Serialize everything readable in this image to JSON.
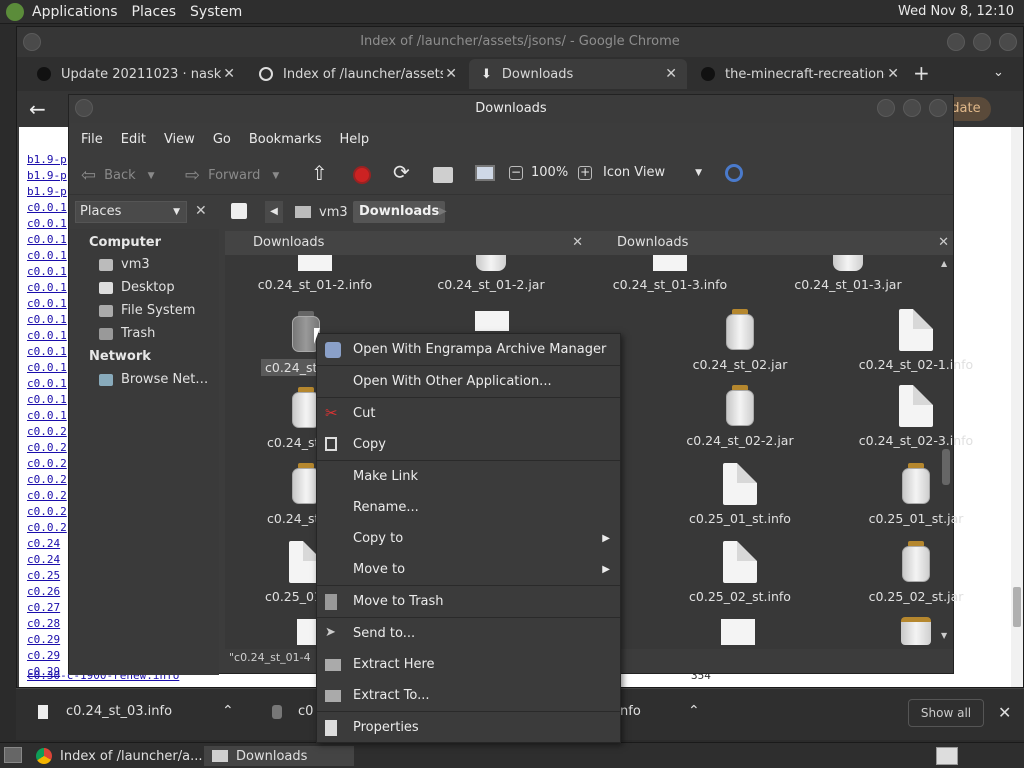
{
  "top_panel": {
    "applications": "Applications",
    "places": "Places",
    "system": "System",
    "clock": "Wed Nov  8, 12:10"
  },
  "chrome": {
    "title": "Index of /launcher/assets/jsons/ - Google Chrome",
    "tabs": [
      {
        "label": "Update 20211023 · nasko22"
      },
      {
        "label": "Index of /launcher/assets/j"
      },
      {
        "label": "Downloads"
      },
      {
        "label": "the-minecraft-recreation-"
      }
    ],
    "new_tab": "+",
    "update_btn": "pdate",
    "links": [
      "b1.9-p",
      "b1.9-p",
      "b1.9-p",
      "c0.0.1",
      "c0.0.1",
      "c0.0.1",
      "c0.0.1",
      "c0.0.1",
      "c0.0.1",
      "c0.0.1",
      "c0.0.1",
      "c0.0.1",
      "c0.0.1",
      "c0.0.1",
      "c0.0.1",
      "c0.0.1",
      "c0.0.1",
      "c0.0.2",
      "c0.0.2",
      "c0.0.2",
      "c0.0.2",
      "c0.0.2",
      "c0.0.2",
      "c0.0.2",
      "c0.24",
      "c0.24",
      "c0.25",
      "c0.26",
      "c0.27",
      "c0.28",
      "c0.29",
      "c0.29",
      "c0.29"
    ],
    "last_link": "c0.30-c-1900-renew.info",
    "last_size": "354"
  },
  "downloads_bar": {
    "item1": "c0.24_st_03.info",
    "item2": "c0",
    "item3_suffix": "nfo",
    "show_all": "Show all"
  },
  "taskbar": {
    "task1": "Index of /launcher/a...",
    "task2": "Downloads"
  },
  "caja": {
    "title": "Downloads",
    "menu": [
      "File",
      "Edit",
      "View",
      "Go",
      "Bookmarks",
      "Help"
    ],
    "toolbar": {
      "back": "Back",
      "forward": "Forward",
      "zoom": "100%",
      "view": "Icon View"
    },
    "path": {
      "seg1": "vm3",
      "seg2": "Downloads"
    },
    "sidebar": {
      "selector": "Places",
      "computer": "Computer",
      "items": [
        "vm3",
        "Desktop",
        "File System",
        "Trash"
      ],
      "network": "Network",
      "net_items": [
        "Browse Net…"
      ]
    },
    "paneA": {
      "title": "Downloads"
    },
    "paneB": {
      "title": "Downloads"
    },
    "filesA": [
      {
        "name": "c0.24_st_01-2.info",
        "type": "doc"
      },
      {
        "name": "c0.24_st_01-2.jar",
        "type": "jar"
      },
      {
        "name": "c0.24_st",
        "type": "jar"
      },
      {
        "name": "c0.24_st",
        "type": "jar"
      },
      {
        "name": "c0.24_st",
        "type": "jar"
      },
      {
        "name": "c0.25_01",
        "type": "doc"
      }
    ],
    "filesB": [
      {
        "name": "c0.24_st_01-3.info",
        "type": "doc"
      },
      {
        "name": "c0.24_st_01-3.jar",
        "type": "jar"
      },
      {
        "name": "c0.24_st_02.jar",
        "type": "jar"
      },
      {
        "name": "c0.24_st_02-1.info",
        "type": "doc"
      },
      {
        "name": "c0.24_st_02-2.jar",
        "type": "jar"
      },
      {
        "name": "c0.24_st_02-3.info",
        "type": "doc"
      },
      {
        "name": "c0.25_01_st.info",
        "type": "doc"
      },
      {
        "name": "c0.25_01_st.jar",
        "type": "jar"
      },
      {
        "name": "c0.25_02_st.info",
        "type": "doc"
      },
      {
        "name": "c0.25_02_st.jar",
        "type": "jar"
      }
    ],
    "status": "\"c0.24_st_01-4"
  },
  "context_menu": [
    {
      "label": "Open With Engrampa Archive Manager",
      "icon": "archive-icon"
    },
    {
      "label": "Open With Other Application...",
      "icon": ""
    },
    {
      "label": "Cut",
      "icon": "scissors-icon"
    },
    {
      "label": "Copy",
      "icon": "copy-icon"
    },
    {
      "label": "Make Link",
      "icon": ""
    },
    {
      "label": "Rename...",
      "icon": ""
    },
    {
      "label": "Copy to",
      "icon": "",
      "submenu": true
    },
    {
      "label": "Move to",
      "icon": "",
      "submenu": true
    },
    {
      "label": "Move to Trash",
      "icon": "trash-icon"
    },
    {
      "label": "Send to...",
      "icon": "send-icon"
    },
    {
      "label": "Extract Here",
      "icon": "extract-icon"
    },
    {
      "label": "Extract To...",
      "icon": "extract-to-icon"
    },
    {
      "label": "Properties",
      "icon": "properties-icon"
    }
  ]
}
